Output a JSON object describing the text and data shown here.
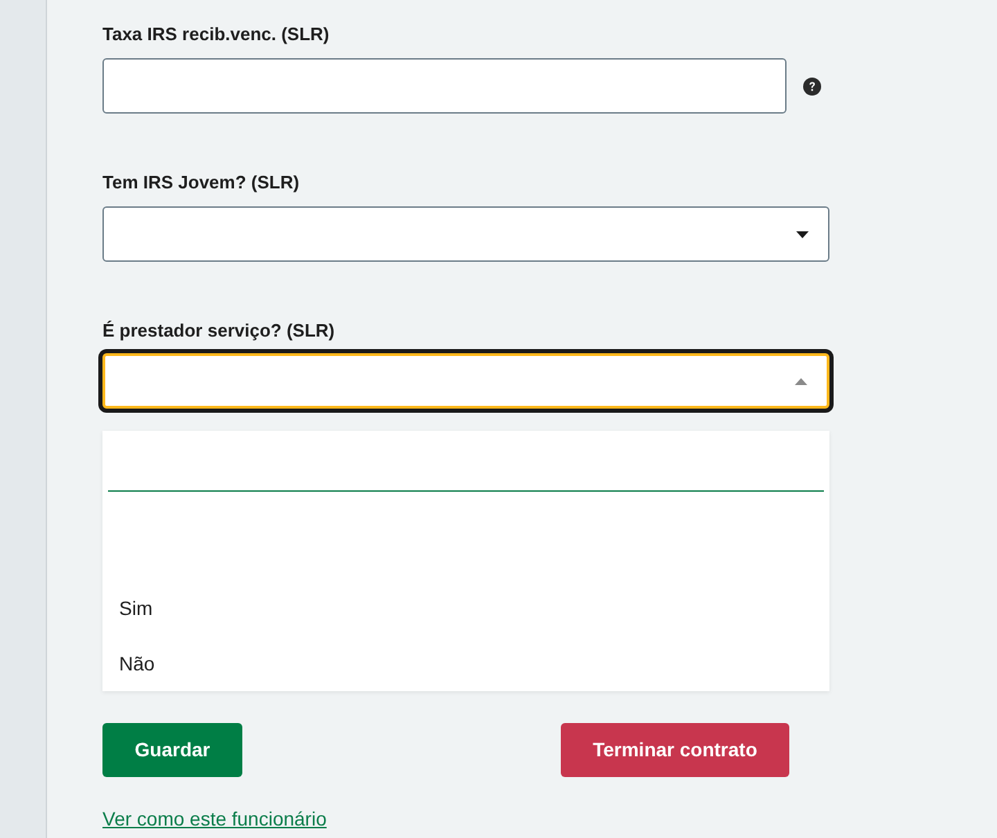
{
  "fields": [
    {
      "label": "Taxa IRS recib.venc. (SLR)",
      "kind": "text",
      "help": true,
      "focused": false
    },
    {
      "label": "Tem IRS Jovem? (SLR)",
      "kind": "select",
      "expanded": false,
      "focused": false
    },
    {
      "label": "É prestador serviço? (SLR)",
      "kind": "select",
      "expanded": true,
      "focused": true
    }
  ],
  "dropdown": {
    "options": [
      {
        "label": "Sim",
        "selected": false
      },
      {
        "label": "Não",
        "selected": false
      }
    ]
  },
  "buttons": [
    {
      "label": "Guardar",
      "kind": "primary"
    },
    {
      "label": "Terminar contrato",
      "kind": "danger"
    }
  ],
  "link": "Ver como este funcionário"
}
